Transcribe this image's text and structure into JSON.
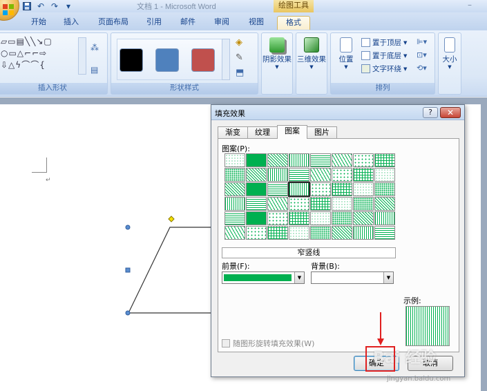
{
  "window": {
    "title": "文档 1 - Microsoft Word",
    "tool_context": "绘图工具"
  },
  "quick_access": [
    "save-icon",
    "undo-icon",
    "redo-icon",
    "customize-icon"
  ],
  "tabs": [
    {
      "label": "开始",
      "active": false
    },
    {
      "label": "插入",
      "active": false
    },
    {
      "label": "页面布局",
      "active": false
    },
    {
      "label": "引用",
      "active": false
    },
    {
      "label": "邮件",
      "active": false
    },
    {
      "label": "审阅",
      "active": false
    },
    {
      "label": "视图",
      "active": false
    },
    {
      "label": "格式",
      "active": true
    }
  ],
  "ribbon": {
    "insert_shapes_label": "插入形状",
    "shape_styles_label": "形状样式",
    "style_swatches": [
      "#000000",
      "#4f81bd",
      "#c0504d"
    ],
    "shadow_effects": "阴影效果",
    "threed_effects": "三维效果",
    "position": "位置",
    "bring_to_front": "置于顶层",
    "send_to_back": "置于底层",
    "text_wrapping": "文字环绕",
    "arrange_label": "排列",
    "size": "大小"
  },
  "dialog": {
    "title": "填充效果",
    "help": "?",
    "close": "✕",
    "tabs": [
      {
        "label": "渐变",
        "active": false
      },
      {
        "label": "纹理",
        "active": false
      },
      {
        "label": "图案",
        "active": true
      },
      {
        "label": "图片",
        "active": false
      }
    ],
    "pattern_label": "图案(P):",
    "selected_pattern_name": "窄竖线",
    "foreground_label": "前景(F):",
    "background_label": "背景(B):",
    "foreground_color": "#00b050",
    "background_color": "#ffffff",
    "example_label": "示例:",
    "rotate_with_shape": "随图形旋转填充效果(W)",
    "ok": "确定",
    "cancel": "取消"
  },
  "watermark": {
    "main": "Bai 经验",
    "sub": "jingyan.baidu.com"
  }
}
